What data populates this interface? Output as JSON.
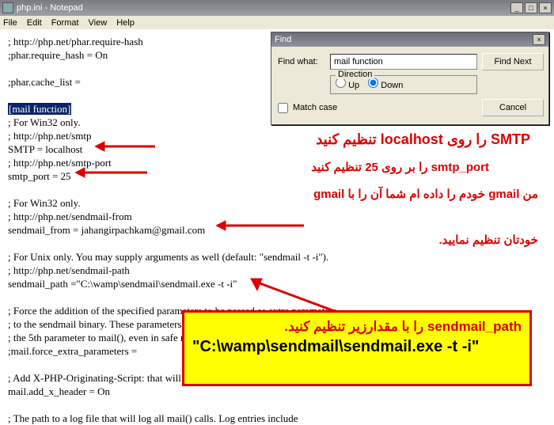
{
  "window": {
    "title": "php.ini - Notepad",
    "buttons": {
      "min": "_",
      "max": "□",
      "close": "×"
    }
  },
  "menu": {
    "file": "File",
    "edit": "Edit",
    "format": "Format",
    "view": "View",
    "help": "Help"
  },
  "find": {
    "title": "Find",
    "label": "Find what:",
    "value": "mail function",
    "findnext": "Find Next",
    "cancel": "Cancel",
    "matchcase": "Match case",
    "direction": "Direction",
    "up": "Up",
    "down": "Down"
  },
  "text": {
    "l1": "; http://php.net/phar.require-hash",
    "l2": ";phar.require_hash = On",
    "l3": ";phar.cache_list =",
    "l4": "[mail function]",
    "l5": "; For Win32 only.",
    "l6": "; http://php.net/smtp",
    "l7": "SMTP = localhost",
    "l8": "; http://php.net/smtp-port",
    "l9": "smtp_port = 25",
    "l10": "; For Win32 only.",
    "l11": "; http://php.net/sendmail-from",
    "l12": "sendmail_from = jahangirpachkam@gmail.com",
    "l13": "; For Unix only.  You may supply arguments as well (default: \"sendmail -t -i\").",
    "l14": "; http://php.net/sendmail-path",
    "l15": "sendmail_path =\"C:\\wamp\\sendmail\\sendmail.exe -t -i\"",
    "l16": "; Force the addition of the specified parameters to be passed as extra parameters",
    "l17": "; to the sendmail binary. These parameters will always replace the value of",
    "l18": "; the 5th parameter to mail(), even in safe mode.",
    "l19": ";mail.force_extra_parameters =",
    "l20": "; Add X-PHP-Originating-Script: that will include uid of the script followed by the filename",
    "l21": "mail.add_x_header = On",
    "l22": "; The path to a log file that will log all mail() calls. Log entries include"
  },
  "annot": {
    "a1": "SMTP را روی localhost تنظیم کنید",
    "a2": "smtp_port را بر روی 25 تنظیم کنید",
    "a3a": "من gmail خودم را داده ام شما آن را با gmail",
    "a3b": "خودتان تنظیم نمایید.",
    "a4a": "sendmail_path را با مقدارزیر تنظیم کنید.",
    "a4b": "\"C:\\wamp\\sendmail\\sendmail.exe -t -i\""
  }
}
